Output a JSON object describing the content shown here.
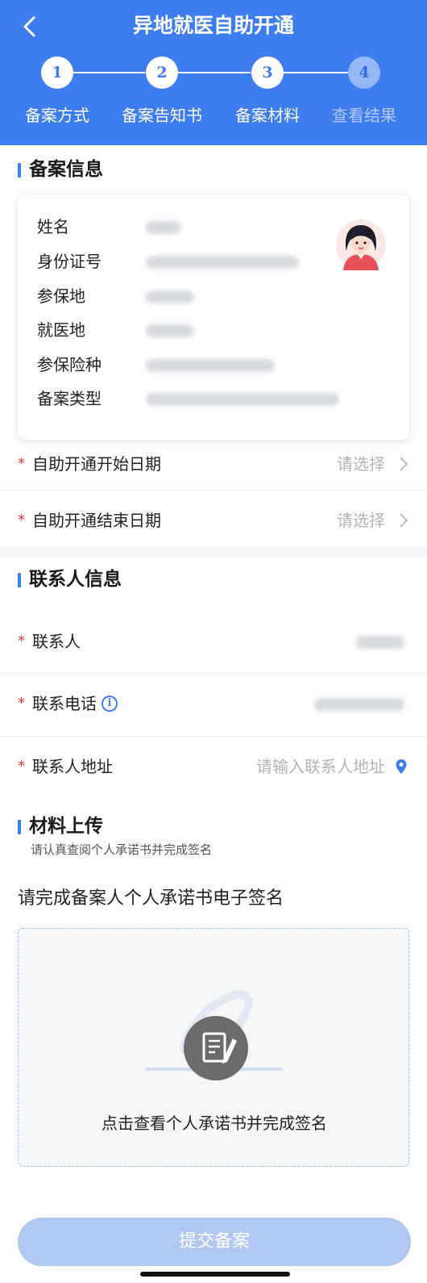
{
  "header": {
    "title": "异地就医自助开通",
    "back_icon": "back-chevron-icon",
    "steps": [
      {
        "num": "1",
        "label": "备案方式",
        "active": true
      },
      {
        "num": "2",
        "label": "备案告知书",
        "active": true
      },
      {
        "num": "3",
        "label": "备案材料",
        "active": true
      },
      {
        "num": "4",
        "label": "查看结果",
        "active": false
      }
    ]
  },
  "filing_info": {
    "section_title": "备案信息",
    "fields": [
      {
        "label": "姓名",
        "value_blurred": true
      },
      {
        "label": "身份证号",
        "value_blurred": true
      },
      {
        "label": "参保地",
        "value_blurred": true
      },
      {
        "label": "就医地",
        "value_blurred": true
      },
      {
        "label": "参保险种",
        "value_blurred": true
      },
      {
        "label": "备案类型",
        "value_blurred": true
      }
    ],
    "avatar_icon": "female-avatar-icon"
  },
  "dates": {
    "start_label": "自助开通开始日期",
    "start_value": "请选择",
    "end_label": "自助开通结束日期",
    "end_value": "请选择",
    "required_mark": "*"
  },
  "contact": {
    "section_title": "联系人信息",
    "name_label": "联系人",
    "phone_label": "联系电话",
    "phone_info_icon": "i",
    "address_label": "联系人地址",
    "address_placeholder": "请输入联系人地址",
    "address_icon": "location-pin-icon"
  },
  "materials": {
    "section_title": "材料上传",
    "hint": "请认真查阅个人承诺书并完成签名",
    "sign_title": "请完成备案人个人承诺书电子签名",
    "upload_caption": "点击查看个人承诺书并完成签名",
    "upload_icon": "sign-document-icon"
  },
  "submit_label": "提交备案",
  "colors": {
    "primary": "#3d7df0",
    "required": "#e23b3b",
    "submit_disabled": "#b0c8f2"
  }
}
